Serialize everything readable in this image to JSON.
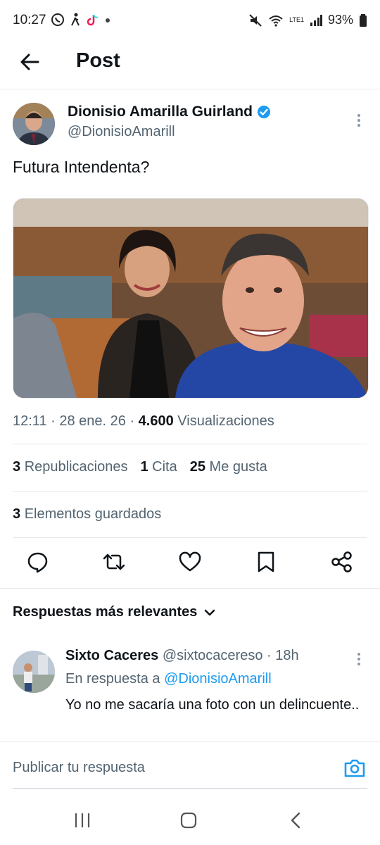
{
  "status_bar": {
    "time": "10:27",
    "battery": "93%",
    "network_label": "LTE1"
  },
  "header": {
    "title": "Post"
  },
  "post": {
    "author_name": "Dionisio Amarilla Guirland",
    "author_handle": "@DionisioAmarill",
    "text": "Futura Intendenta?",
    "time": "12:11",
    "date": "28 ene. 26",
    "views_count": "4.600",
    "views_label": "Visualizaciones",
    "reposts_count": "3",
    "reposts_label": "Republicaciones",
    "quotes_count": "1",
    "quotes_label": "Cita",
    "likes_count": "25",
    "likes_label": "Me gusta",
    "bookmarks_count": "3",
    "bookmarks_label": "Elementos guardados",
    "verified_color": "#1d9bf0"
  },
  "replies": {
    "sort_label": "Respuestas más relevantes",
    "items": [
      {
        "name": "Sixto Caceres",
        "handle": "@sixtocacereso",
        "age": "18h",
        "reply_prefix": "En respuesta a",
        "reply_to": "@DionisioAmarill",
        "text": "Yo no me sacaría una foto con un delincuente.."
      }
    ]
  },
  "composer": {
    "placeholder": "Publicar tu respuesta"
  },
  "colors": {
    "accent": "#1d9bf0",
    "text_secondary": "#536471"
  }
}
